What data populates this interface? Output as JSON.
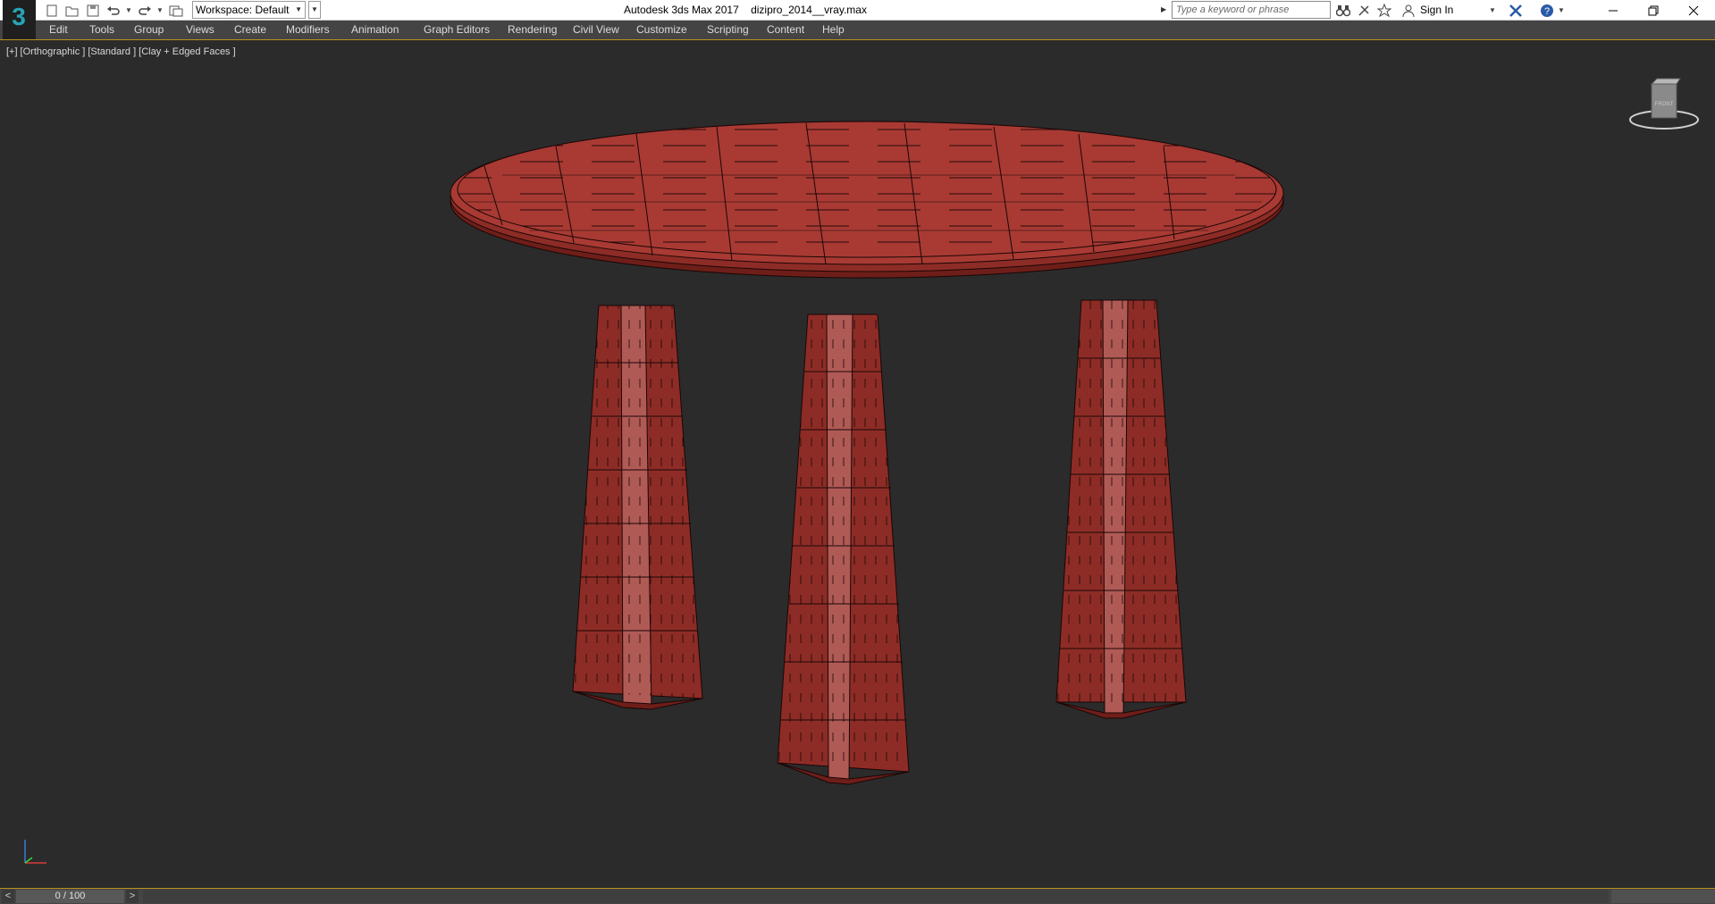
{
  "app": {
    "title": "Autodesk 3ds Max 2017",
    "file": "dizipro_2014__vray.max",
    "logo_text": "3",
    "logo_color": "#27a4b6"
  },
  "quick_access": {
    "icons": [
      "new-file-icon",
      "open-file-icon",
      "save-icon",
      "undo-icon",
      "redo-icon",
      "project-folder-icon"
    ]
  },
  "workspace": {
    "label": "Workspace: Default"
  },
  "search": {
    "placeholder": "Type a keyword or phrase"
  },
  "infocenter": {
    "sign_in": "Sign In"
  },
  "menu": [
    "Edit",
    "Tools",
    "Group",
    "Views",
    "Create",
    "Modifiers",
    "Animation",
    "Graph Editors",
    "Rendering",
    "Civil View",
    "Customize",
    "Scripting",
    "Content",
    "Help"
  ],
  "viewport": {
    "labels": [
      "[+]",
      "[Orthographic ]",
      "[Standard ]",
      "[Clay + Edged Faces ]"
    ],
    "viewcube_face": "FRONT",
    "object_color": "#a83a33",
    "edge_color": "#1a0606",
    "background": "#2b2b2b"
  },
  "timeline": {
    "prev": "<",
    "next": ">",
    "frame_display": "0 / 100"
  },
  "colors": {
    "menubar_bg": "#444444",
    "accent_border": "#b8901e"
  }
}
